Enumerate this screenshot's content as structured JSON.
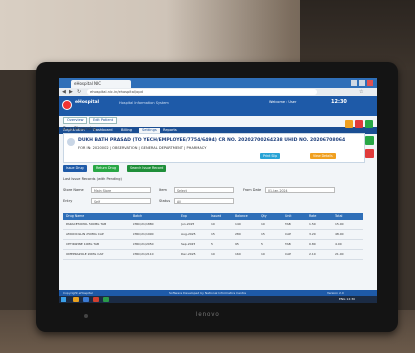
{
  "browser": {
    "tab_title": "eHospital NIC",
    "url": "ehospital.nic.in/ehospital/opd"
  },
  "app": {
    "name": "eHospital",
    "tagline": "Hospital Information System",
    "user": "Welcome : User",
    "time": "12:30",
    "menu": [
      "Registration",
      "Dashboard",
      "Billing",
      "Settings",
      "Reports"
    ],
    "active_menu_index": 3
  },
  "content": {
    "subtabs": [
      "Overview",
      "Edit Patient"
    ],
    "breadcrumb": "Drug Dispensing",
    "patient": {
      "name": "DUKH BATH PRASAD (TO YECH/EMPLOYEE/7754/6494) CR NO. 20202700264238 UHID NO. 20206708064",
      "meta": "FOR IN: 2020002 | OBSERVATION | GENERAL DEPARTMENT | PHARMACY",
      "btn1": "Print Slip",
      "btn2": "View Details"
    },
    "buttons": [
      "Issue Drug",
      "Return Drug",
      "Search Issue Record"
    ],
    "section_label": "Last Issue Records (with Pending)",
    "filters": {
      "store_label": "Store Name",
      "store_value": "Main Store",
      "type_label": "Item",
      "type_value": "Select",
      "date_label": "From Date",
      "date_value": "01-Jan-2024",
      "by_label": "Entry",
      "by_value": "Self",
      "status_label": "Status",
      "status_value": "All"
    },
    "table": {
      "headers": [
        "Drug Name",
        "Batch",
        "Exp",
        "Issued",
        "Balance",
        "Qty",
        "Unit",
        "Rate",
        "Total"
      ],
      "rows": [
        [
          "PARACETAMOL 500MG TAB",
          "LTRC/21/1880",
          "Jun-2025",
          "10",
          "140",
          "10",
          "TAB",
          "1.50",
          "15.00"
        ],
        [
          "AMOXICILLIN 250MG CAP",
          "LTRC/21/1990",
          "Aug-2025",
          "15",
          "280",
          "15",
          "CAP",
          "3.20",
          "48.00"
        ],
        [
          "CETIRIZINE 10MG TAB",
          "LTRC/21/2050",
          "Sep-2025",
          "5",
          "95",
          "5",
          "TAB",
          "0.80",
          "4.00"
        ],
        [
          "OMEPRAZOLE 20MG CAP",
          "LTRC/21/2110",
          "Dec-2025",
          "10",
          "160",
          "10",
          "CAP",
          "2.10",
          "21.00"
        ]
      ]
    }
  },
  "footer": {
    "left": "Copyright eHospital",
    "center": "Software Developed by National Informatics Centre",
    "right": "Version 2.0"
  },
  "taskbar": {
    "tray_text": "ENG 12:30"
  },
  "monitor": {
    "brand": "lenovo"
  },
  "colors": {
    "primary": "#1e5aa8",
    "green": "#28a745",
    "orange": "#f0a020",
    "red": "#e03b3b"
  }
}
